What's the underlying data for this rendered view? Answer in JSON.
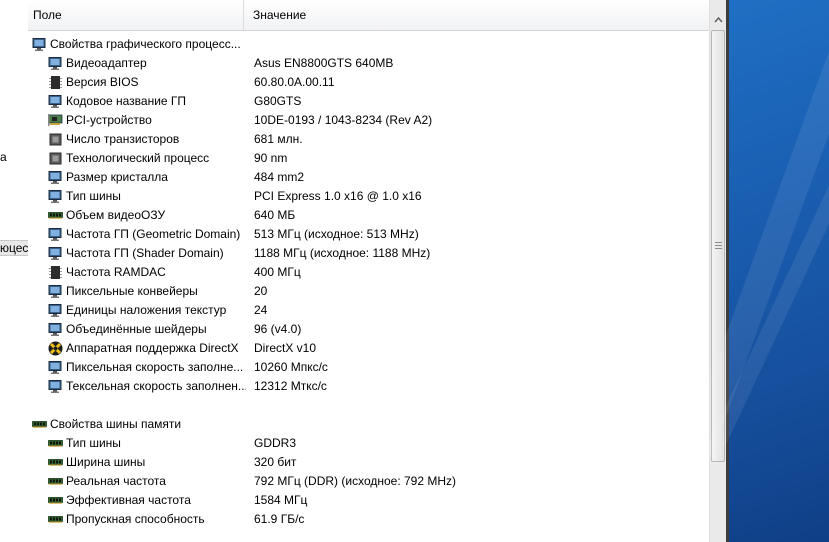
{
  "left_panel": {
    "fragments": [
      "а",
      "юцесс"
    ]
  },
  "header": {
    "field_label": "Поле",
    "value_label": "Значение"
  },
  "groups": [
    {
      "title": "Свойства графического процесс...",
      "icon": "monitor-icon",
      "rows": [
        {
          "field": "Видеоадаптер",
          "value": "Asus EN8800GTS 640MB",
          "icon": "monitor-icon"
        },
        {
          "field": "Версия BIOS",
          "value": "60.80.0A.00.11",
          "icon": "chip-icon"
        },
        {
          "field": "Кодовое название ГП",
          "value": "G80GTS",
          "icon": "monitor-icon"
        },
        {
          "field": "PCI-устройство",
          "value": "10DE-0193 / 1043-8234  (Rev A2)",
          "icon": "pci-card-icon"
        },
        {
          "field": "Число транзисторов",
          "value": "681 млн.",
          "icon": "cpu-icon"
        },
        {
          "field": "Технологический процесс",
          "value": "90 nm",
          "icon": "cpu-icon"
        },
        {
          "field": "Размер кристалла",
          "value": "484 mm2",
          "icon": "monitor-icon"
        },
        {
          "field": "Тип шины",
          "value": "PCI Express 1.0 x16 @ 1.0 x16",
          "icon": "monitor-icon"
        },
        {
          "field": "Объем видеоОЗУ",
          "value": "640 МБ",
          "icon": "memory-icon"
        },
        {
          "field": "Частота ГП (Geometric Domain)",
          "value": "513 МГц  (исходное: 513 MHz)",
          "icon": "monitor-icon"
        },
        {
          "field": "Частота ГП (Shader Domain)",
          "value": "1188 МГц  (исходное: 1188 MHz)",
          "icon": "monitor-icon"
        },
        {
          "field": "Частота RAMDAC",
          "value": "400 МГц",
          "icon": "chip-icon"
        },
        {
          "field": "Пиксельные конвейеры",
          "value": "20",
          "icon": "monitor-icon"
        },
        {
          "field": "Единицы наложения текстур",
          "value": "24",
          "icon": "monitor-icon"
        },
        {
          "field": "Объединённые шейдеры",
          "value": "96  (v4.0)",
          "icon": "monitor-icon"
        },
        {
          "field": "Аппаратная поддержка DirectX",
          "value": "DirectX v10",
          "icon": "directx-icon"
        },
        {
          "field": "Пиксельная скорость заполне...",
          "value": "10260 Мпкс/с",
          "icon": "monitor-icon"
        },
        {
          "field": "Тексельная скорость заполнен...",
          "value": "12312 Мткс/с",
          "icon": "monitor-icon"
        }
      ]
    },
    {
      "title": "Свойства шины памяти",
      "icon": "memory-icon",
      "rows": [
        {
          "field": "Тип шины",
          "value": "GDDR3",
          "icon": "memory-icon"
        },
        {
          "field": "Ширина шины",
          "value": "320 бит",
          "icon": "memory-icon"
        },
        {
          "field": "Реальная частота",
          "value": "792 МГц (DDR)  (исходное: 792 MHz)",
          "icon": "memory-icon"
        },
        {
          "field": "Эффективная частота",
          "value": "1584 МГц",
          "icon": "memory-icon"
        },
        {
          "field": "Пропускная способность",
          "value": "61.9 ГБ/с",
          "icon": "memory-icon"
        }
      ]
    }
  ]
}
